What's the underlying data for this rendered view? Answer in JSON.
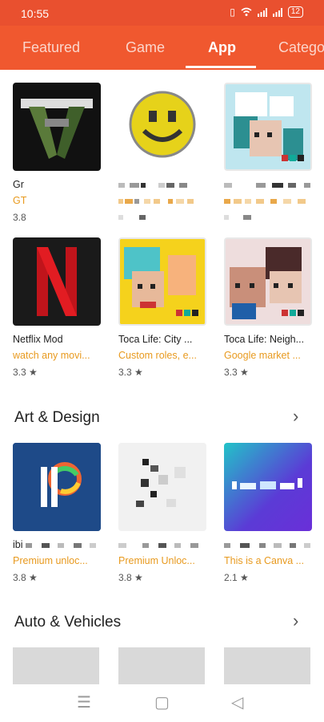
{
  "status": {
    "time": "10:55",
    "battery": "12"
  },
  "tabs": [
    "Featured",
    "Game",
    "App",
    "Catego"
  ],
  "active_tab": "App",
  "grid": [
    {
      "name": "Gr",
      "desc": "GT",
      "rating": "3.8"
    },
    {
      "name": "",
      "desc": "",
      "rating": ""
    },
    {
      "name": "",
      "desc": "",
      "rating": ""
    },
    {
      "name": "Netflix Mod",
      "desc": "watch any movi...",
      "rating": "3.3"
    },
    {
      "name": "Toca Life: City ...",
      "desc": "Custom roles, e...",
      "rating": "3.3"
    },
    {
      "name": "Toca Life: Neigh...",
      "desc": "Google market ...",
      "rating": "3.3"
    }
  ],
  "sections": [
    {
      "title": "Art & Design",
      "items": [
        {
          "name": "ibi",
          "desc": "Premium unloc...",
          "rating": "3.8"
        },
        {
          "name": "",
          "desc": "Premium Unloc...",
          "rating": "3.8"
        },
        {
          "name": "",
          "desc": "This is a Canva ...",
          "rating": "2.1"
        }
      ]
    },
    {
      "title": "Auto & Vehicles"
    }
  ],
  "icons": {
    "star": "★",
    "chevron": "›",
    "menu": "☰",
    "home": "▢",
    "back": "◁",
    "vibrate": "▯",
    "wifi": "wifi-icon",
    "signal": "signal-icon"
  },
  "colors": {
    "accent": "#f0582f",
    "desc": "#e89a1f"
  }
}
